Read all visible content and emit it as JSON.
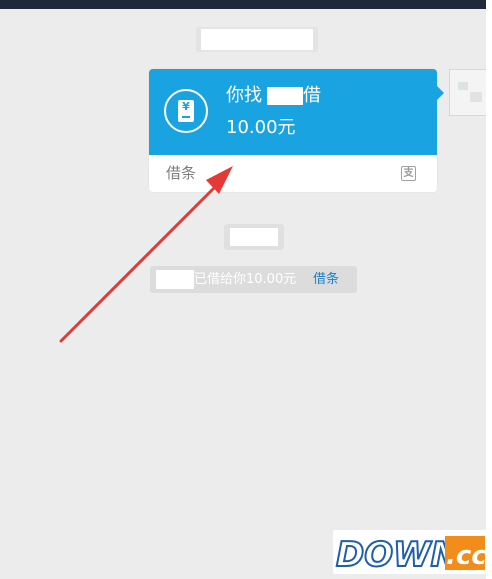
{
  "card": {
    "title_prefix": "你找",
    "title_suffix": "借",
    "amount": "10.00元",
    "label": "借条",
    "icon": "yuan-receipt-icon",
    "badge_icon": "alipay-icon",
    "badge_glyph": "支"
  },
  "notice": {
    "text": "已借给你10.00元",
    "link": "借条"
  },
  "watermark": {
    "text_main": "DOWN",
    "text_suffix": ".cc"
  },
  "colors": {
    "accent": "#1aa3e1",
    "background": "#ececec",
    "annotation_arrow": "#e53935",
    "link": "#1e7fc6"
  }
}
